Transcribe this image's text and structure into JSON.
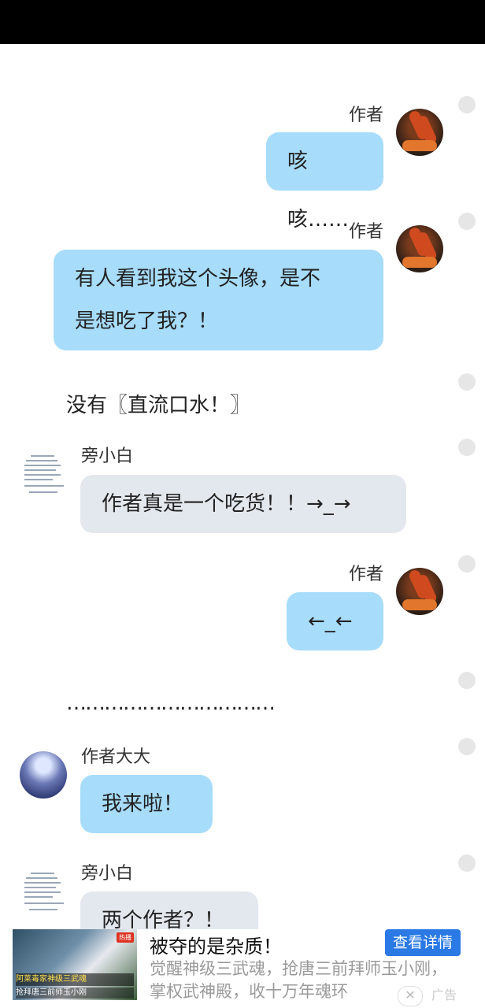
{
  "messages": [
    {
      "type": "right",
      "name": "作者",
      "avatar": "food-avatar",
      "text": "咳咳……"
    },
    {
      "type": "right",
      "name": "作者",
      "avatar": "food-avatar",
      "lines": [
        "有人看到我这个头像，是不",
        "是想吃了我？！"
      ]
    },
    {
      "type": "plain",
      "text": "没有〖直流口水！〗"
    },
    {
      "type": "left",
      "name": "旁小白",
      "avatar": "document-avatar",
      "text": "作者真是一个吃货！！→_→"
    },
    {
      "type": "right",
      "name": "作者",
      "avatar": "food-avatar",
      "text": "←_←"
    },
    {
      "type": "plain",
      "text": "……………………………"
    },
    {
      "type": "left",
      "name": "作者大大",
      "avatar": "anime-avatar",
      "text": "我来啦！"
    },
    {
      "type": "left",
      "name": "旁小白",
      "avatar": "document-avatar",
      "text": "两个作者？！"
    }
  ],
  "ad": {
    "title": "被夺的是杂质！",
    "cta": "查看详情",
    "desc_line1": "觉醒神级三武魂，抢唐三前拜师玉小刚，",
    "desc_line2": "掌权武神殿，收十万年魂环",
    "label": "广告",
    "thumb_caption": "阿莱毒家神级三武魂",
    "thumb_caption2": "抢拜唐三前师玉小刚",
    "thumb_tag": "热播",
    "close_icon": "close-icon"
  },
  "colors": {
    "bubble_blue": "#a7dcfb",
    "bubble_gray": "#e3e8ee",
    "status_bar": "#000000",
    "cta_blue": "#2a79e4"
  }
}
